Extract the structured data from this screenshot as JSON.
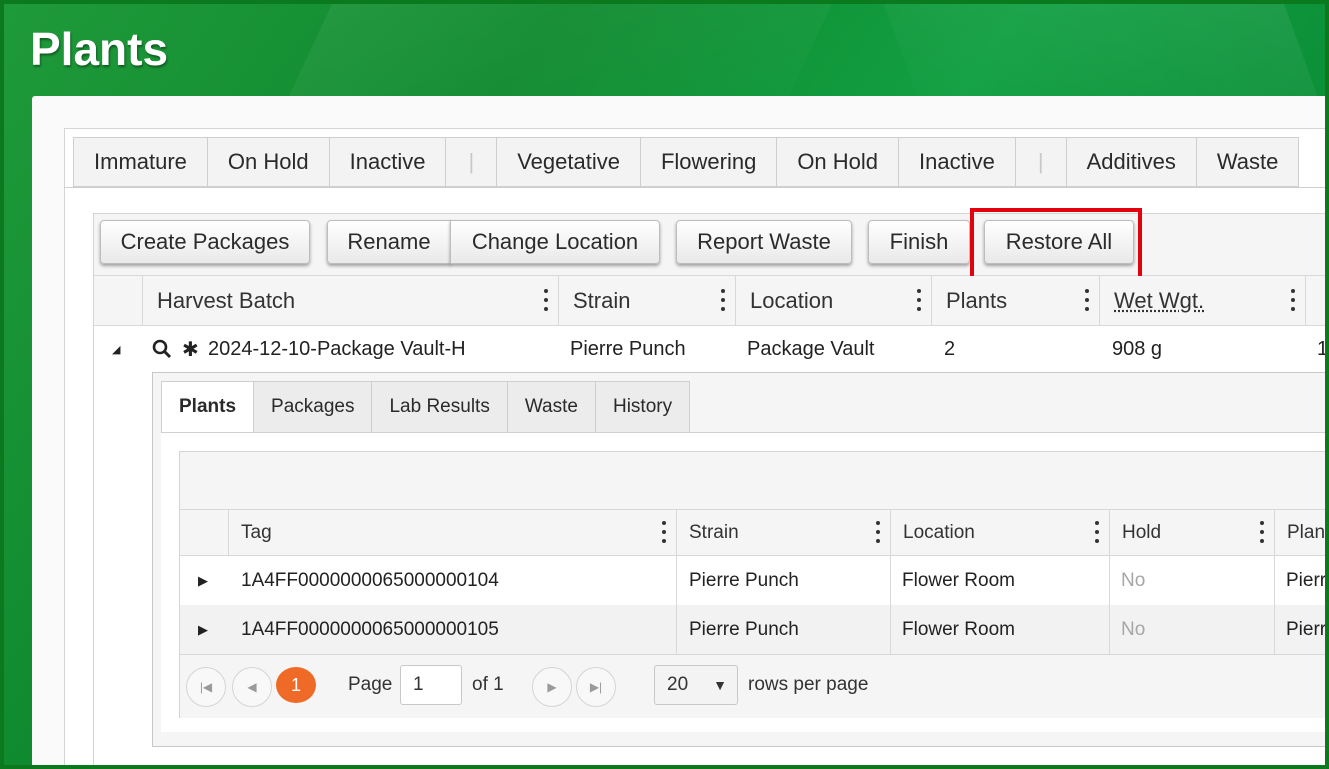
{
  "page": {
    "title": "Plants"
  },
  "top_tabs": [
    {
      "label": "Immature"
    },
    {
      "label": "On Hold"
    },
    {
      "label": "Inactive"
    },
    {
      "label": "|"
    },
    {
      "label": "Vegetative"
    },
    {
      "label": "Flowering"
    },
    {
      "label": "On Hold"
    },
    {
      "label": "Inactive"
    },
    {
      "label": "|"
    },
    {
      "label": "Additives"
    },
    {
      "label": "Waste"
    }
  ],
  "toolbar": {
    "create_packages": "Create Packages",
    "rename": "Rename",
    "change_location": "Change Location",
    "report_waste": "Report Waste",
    "finish": "Finish",
    "restore_all": "Restore All"
  },
  "grid": {
    "columns": [
      "Harvest Batch",
      "Strain",
      "Location",
      "Plants",
      "Wet Wgt."
    ],
    "row": {
      "harvest_batch": "2024-12-10-Package Vault-H",
      "strain": "Pierre Punch",
      "location": "Package Vault",
      "plants": "2",
      "wet_weight": "908 g",
      "next_col_partial": "1"
    }
  },
  "detail_tabs": [
    "Plants",
    "Packages",
    "Lab Results",
    "Waste",
    "History"
  ],
  "subgrid": {
    "columns": [
      "Tag",
      "Strain",
      "Location",
      "Hold",
      "Plan"
    ],
    "rows": [
      {
        "tag": "1A4FF0000000065000000104",
        "strain": "Pierre Punch",
        "location": "Flower Room",
        "hold": "No",
        "partial": "Pierr"
      },
      {
        "tag": "1A4FF0000000065000000105",
        "strain": "Pierre Punch",
        "location": "Flower Room",
        "hold": "No",
        "partial": "Pierr"
      }
    ]
  },
  "pager": {
    "current_page": "1",
    "page_label": "Page",
    "page_value": "1",
    "of_label": "of 1",
    "page_size": "20",
    "rows_per_page": "rows per page"
  }
}
